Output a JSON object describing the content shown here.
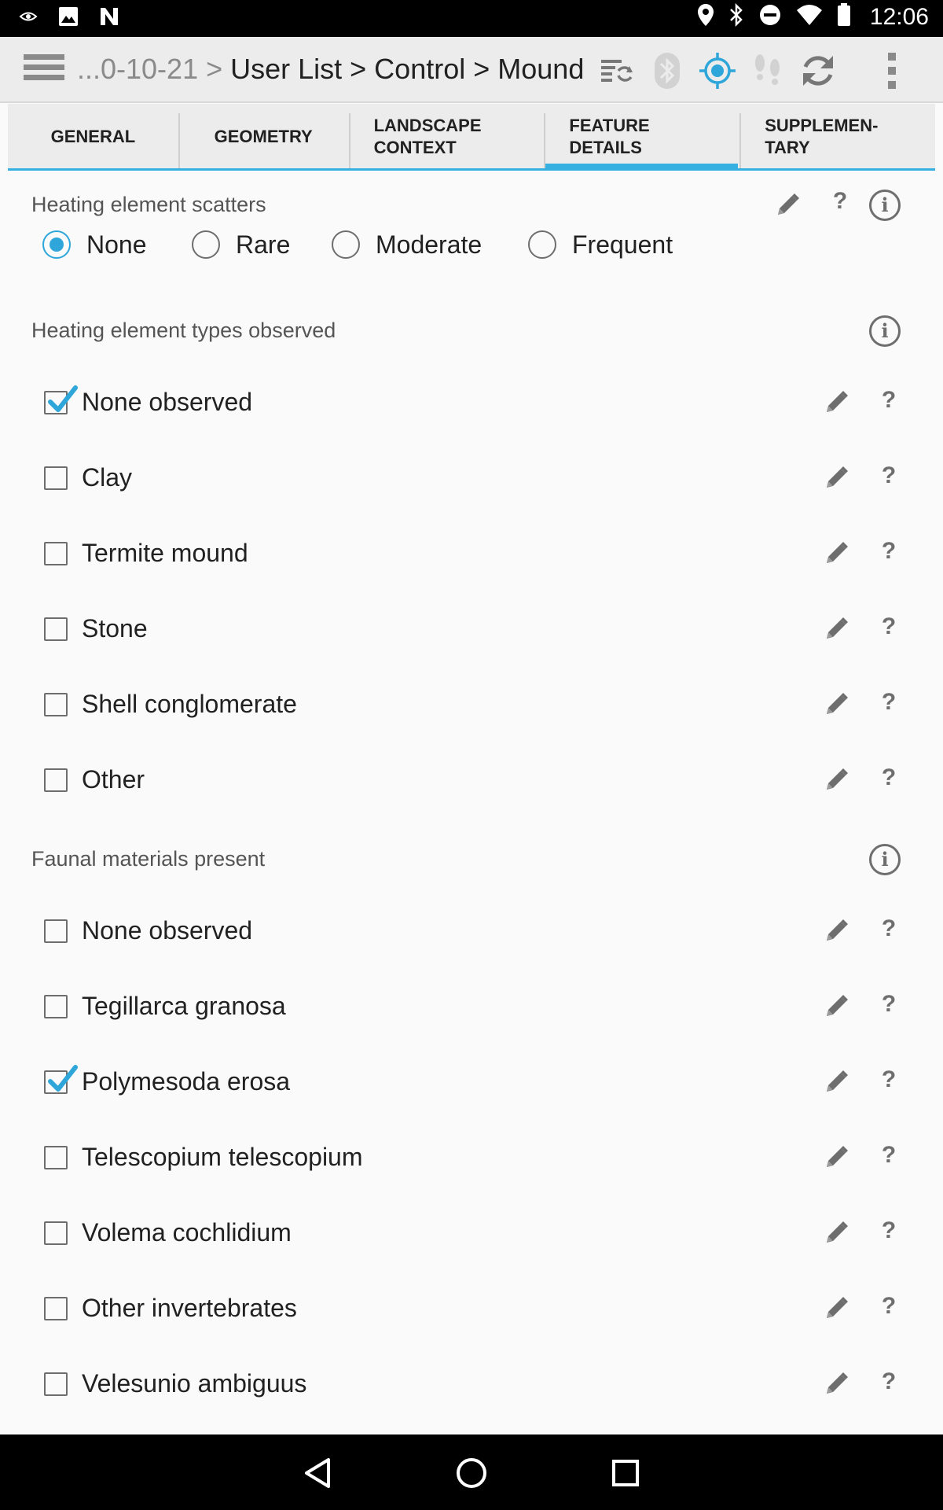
{
  "status_bar": {
    "time": "12:06",
    "left_icons": [
      "nvidia-icon",
      "image-icon",
      "n-logo-icon"
    ],
    "right_icons": [
      "location-icon",
      "bluetooth-icon",
      "do-not-disturb-icon",
      "wifi-icon",
      "battery-icon"
    ]
  },
  "action_bar": {
    "breadcrumb_trail": "...0-10-21 > ",
    "breadcrumb_current": "User List > Control > Mound",
    "icons": [
      "sync-list-icon",
      "bluetooth-icon",
      "gps-icon",
      "footsteps-icon",
      "refresh-icon",
      "overflow-menu-icon"
    ],
    "gps_color": "#2fa6d9"
  },
  "tabs": [
    {
      "line1": "GENERAL",
      "line2": ""
    },
    {
      "line1": "GEOMETRY",
      "line2": ""
    },
    {
      "line1": "LANDSCAPE",
      "line2": "CONTEXT"
    },
    {
      "line1": "FEATURE",
      "line2": "DETAILS"
    },
    {
      "line1": "SUPPLEMEN-",
      "line2": "TARY"
    }
  ],
  "active_tab": "FEATURE DETAILS",
  "accent_color": "#35b0e0",
  "heating_scatters": {
    "title": "Heating element scatters",
    "options": [
      "None",
      "Rare",
      "Moderate",
      "Frequent"
    ],
    "selected": "None"
  },
  "heating_types": {
    "title": "Heating element types observed",
    "items": [
      {
        "label": "None observed",
        "checked": true
      },
      {
        "label": "Clay",
        "checked": false
      },
      {
        "label": "Termite mound",
        "checked": false
      },
      {
        "label": "Stone",
        "checked": false
      },
      {
        "label": "Shell conglomerate",
        "checked": false
      },
      {
        "label": "Other",
        "checked": false
      }
    ]
  },
  "faunal": {
    "title": "Faunal materials present",
    "items": [
      {
        "label": "None observed",
        "checked": false
      },
      {
        "label": "Tegillarca granosa",
        "checked": false
      },
      {
        "label": "Polymesoda erosa",
        "checked": true
      },
      {
        "label": "Telescopium telescopium",
        "checked": false
      },
      {
        "label": "Volema cochlidium",
        "checked": false
      },
      {
        "label": "Other invertebrates",
        "checked": false
      },
      {
        "label": "Velesunio ambiguus",
        "checked": false
      }
    ]
  },
  "help_glyph": "?",
  "info_glyph": "i",
  "nav_bar": [
    "back-icon",
    "home-icon",
    "recents-icon"
  ]
}
